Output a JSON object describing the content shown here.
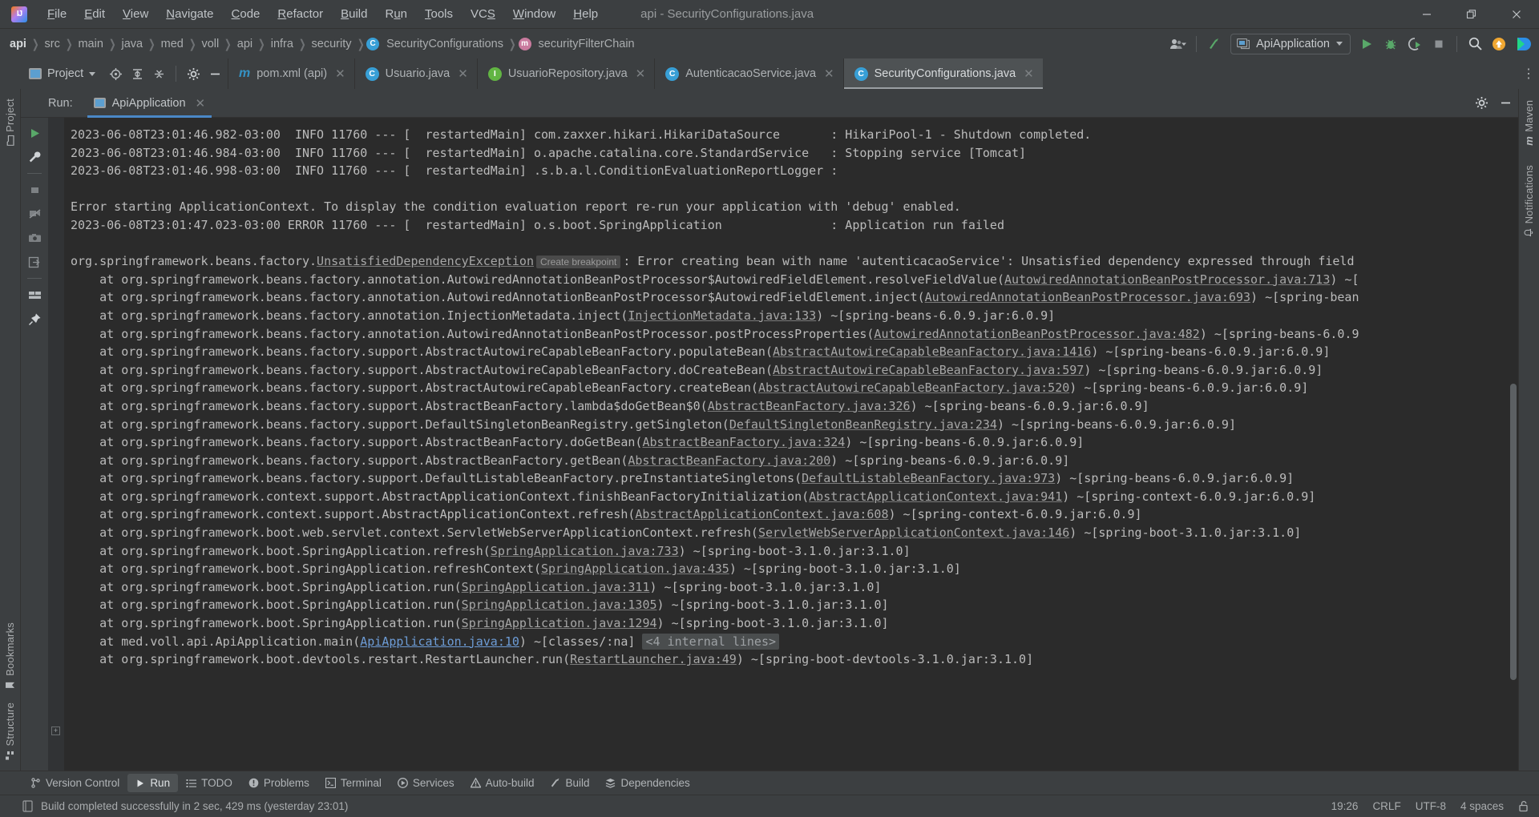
{
  "window": {
    "title": "api - SecurityConfigurations.java",
    "logo_text": "IJ",
    "minimize": "–",
    "maximize": "▢",
    "close": "✕"
  },
  "menu": [
    {
      "label": "File"
    },
    {
      "label": "Edit"
    },
    {
      "label": "View"
    },
    {
      "label": "Navigate"
    },
    {
      "label": "Code"
    },
    {
      "label": "Refactor"
    },
    {
      "label": "Build"
    },
    {
      "label": "Run"
    },
    {
      "label": "Tools"
    },
    {
      "label": "VCS"
    },
    {
      "label": "Window"
    },
    {
      "label": "Help"
    }
  ],
  "breadcrumbs": [
    {
      "label": "api",
      "badge": "",
      "bold": true
    },
    {
      "label": "src",
      "badge": ""
    },
    {
      "label": "main",
      "badge": ""
    },
    {
      "label": "java",
      "badge": ""
    },
    {
      "label": "med",
      "badge": ""
    },
    {
      "label": "voll",
      "badge": ""
    },
    {
      "label": "api",
      "badge": ""
    },
    {
      "label": "infra",
      "badge": ""
    },
    {
      "label": "security",
      "badge": ""
    },
    {
      "label": "SecurityConfigurations",
      "badge": "C"
    },
    {
      "label": "securityFilterChain",
      "badge": "m"
    }
  ],
  "toolbar": {
    "run_config": "ApiApplication",
    "icons": [
      "user-avatar-icon",
      "updates-icon",
      "run-config-icon",
      "run-icon",
      "debug-icon",
      "run-coverage-icon",
      "stop-icon",
      "search-everywhere-icon",
      "notifications-icon",
      "ide-services-icon"
    ]
  },
  "project_panel": {
    "title": "Project",
    "tools": [
      "locate-icon",
      "expand-all-icon",
      "collapse-all-icon",
      "settings-icon",
      "hide-icon"
    ]
  },
  "editor_tabs": [
    {
      "label": "pom.xml (api)",
      "badge": "m",
      "badge_type": "maven",
      "active": false
    },
    {
      "label": "Usuario.java",
      "badge": "C",
      "badge_type": "class",
      "active": false
    },
    {
      "label": "UsuarioRepository.java",
      "badge": "I",
      "badge_type": "interface",
      "active": false
    },
    {
      "label": "AutenticacaoService.java",
      "badge": "C",
      "badge_type": "class",
      "active": false
    },
    {
      "label": "SecurityConfigurations.java",
      "badge": "C",
      "badge_type": "class",
      "active": true
    }
  ],
  "run_panel": {
    "label": "Run:",
    "tab": "ApiApplication",
    "side_tools": [
      "rerun-icon",
      "settings-wrench-icon",
      "stop-icon",
      "suppress-icon",
      "camera-icon",
      "export-icon",
      "layout-icon",
      "pin-icon"
    ]
  },
  "console": {
    "lines": [
      {
        "segments": [
          {
            "t": "2023-06-08T23:01:46.982-03:00  INFO 11760 --- [  restartedMain] com.zaxxer.hikari.HikariDataSource       : HikariPool-1 - Shutdown completed."
          }
        ]
      },
      {
        "segments": [
          {
            "t": "2023-06-08T23:01:46.984-03:00  INFO 11760 --- [  restartedMain] o.apache.catalina.core.StandardService   : Stopping service [Tomcat]"
          }
        ]
      },
      {
        "segments": [
          {
            "t": "2023-06-08T23:01:46.998-03:00  INFO 11760 --- [  restartedMain] .s.b.a.l.ConditionEvaluationReportLogger :"
          }
        ]
      },
      {
        "segments": [
          {
            "t": ""
          }
        ]
      },
      {
        "segments": [
          {
            "t": "Error starting ApplicationContext. To display the condition evaluation report re-run your application with 'debug' enabled."
          }
        ]
      },
      {
        "segments": [
          {
            "t": "2023-06-08T23:01:47.023-03:00 ERROR 11760 --- [  restartedMain] o.s.boot.SpringApplication               : Application run failed"
          }
        ]
      },
      {
        "segments": [
          {
            "t": ""
          }
        ]
      },
      {
        "segments": [
          {
            "t": "org.springframework.beans.factory."
          },
          {
            "t": "UnsatisfiedDependencyException",
            "k": "link"
          },
          {
            "t": "Create breakpoint",
            "k": "bkpt"
          },
          {
            "t": ": Error creating bean with name 'autenticacaoService': Unsatisfied dependency expressed through field"
          }
        ]
      },
      {
        "segments": [
          {
            "t": "    at org.springframework.beans.factory.annotation.AutowiredAnnotationBeanPostProcessor$AutowiredFieldElement.resolveFieldValue("
          },
          {
            "t": "AutowiredAnnotationBeanPostProcessor.java:713",
            "k": "link"
          },
          {
            "t": ") ~["
          }
        ]
      },
      {
        "segments": [
          {
            "t": "    at org.springframework.beans.factory.annotation.AutowiredAnnotationBeanPostProcessor$AutowiredFieldElement.inject("
          },
          {
            "t": "AutowiredAnnotationBeanPostProcessor.java:693",
            "k": "link"
          },
          {
            "t": ") ~[spring-bean"
          }
        ]
      },
      {
        "segments": [
          {
            "t": "    at org.springframework.beans.factory.annotation.InjectionMetadata.inject("
          },
          {
            "t": "InjectionMetadata.java:133",
            "k": "link"
          },
          {
            "t": ") ~[spring-beans-6.0.9.jar:6.0.9]"
          }
        ]
      },
      {
        "segments": [
          {
            "t": "    at org.springframework.beans.factory.annotation.AutowiredAnnotationBeanPostProcessor.postProcessProperties("
          },
          {
            "t": "AutowiredAnnotationBeanPostProcessor.java:482",
            "k": "link"
          },
          {
            "t": ") ~[spring-beans-6.0.9"
          }
        ]
      },
      {
        "segments": [
          {
            "t": "    at org.springframework.beans.factory.support.AbstractAutowireCapableBeanFactory.populateBean("
          },
          {
            "t": "AbstractAutowireCapableBeanFactory.java:1416",
            "k": "link"
          },
          {
            "t": ") ~[spring-beans-6.0.9.jar:6.0.9]"
          }
        ]
      },
      {
        "segments": [
          {
            "t": "    at org.springframework.beans.factory.support.AbstractAutowireCapableBeanFactory.doCreateBean("
          },
          {
            "t": "AbstractAutowireCapableBeanFactory.java:597",
            "k": "link"
          },
          {
            "t": ") ~[spring-beans-6.0.9.jar:6.0.9]"
          }
        ]
      },
      {
        "segments": [
          {
            "t": "    at org.springframework.beans.factory.support.AbstractAutowireCapableBeanFactory.createBean("
          },
          {
            "t": "AbstractAutowireCapableBeanFactory.java:520",
            "k": "link"
          },
          {
            "t": ") ~[spring-beans-6.0.9.jar:6.0.9]"
          }
        ]
      },
      {
        "segments": [
          {
            "t": "    at org.springframework.beans.factory.support.AbstractBeanFactory.lambda$doGetBean$0("
          },
          {
            "t": "AbstractBeanFactory.java:326",
            "k": "link"
          },
          {
            "t": ") ~[spring-beans-6.0.9.jar:6.0.9]"
          }
        ]
      },
      {
        "segments": [
          {
            "t": "    at org.springframework.beans.factory.support.DefaultSingletonBeanRegistry.getSingleton("
          },
          {
            "t": "DefaultSingletonBeanRegistry.java:234",
            "k": "link"
          },
          {
            "t": ") ~[spring-beans-6.0.9.jar:6.0.9]"
          }
        ]
      },
      {
        "segments": [
          {
            "t": "    at org.springframework.beans.factory.support.AbstractBeanFactory.doGetBean("
          },
          {
            "t": "AbstractBeanFactory.java:324",
            "k": "link"
          },
          {
            "t": ") ~[spring-beans-6.0.9.jar:6.0.9]"
          }
        ]
      },
      {
        "segments": [
          {
            "t": "    at org.springframework.beans.factory.support.AbstractBeanFactory.getBean("
          },
          {
            "t": "AbstractBeanFactory.java:200",
            "k": "link"
          },
          {
            "t": ") ~[spring-beans-6.0.9.jar:6.0.9]"
          }
        ]
      },
      {
        "segments": [
          {
            "t": "    at org.springframework.beans.factory.support.DefaultListableBeanFactory.preInstantiateSingletons("
          },
          {
            "t": "DefaultListableBeanFactory.java:973",
            "k": "link"
          },
          {
            "t": ") ~[spring-beans-6.0.9.jar:6.0.9]"
          }
        ]
      },
      {
        "segments": [
          {
            "t": "    at org.springframework.context.support.AbstractApplicationContext.finishBeanFactoryInitialization("
          },
          {
            "t": "AbstractApplicationContext.java:941",
            "k": "link"
          },
          {
            "t": ") ~[spring-context-6.0.9.jar:6.0.9]"
          }
        ]
      },
      {
        "segments": [
          {
            "t": "    at org.springframework.context.support.AbstractApplicationContext.refresh("
          },
          {
            "t": "AbstractApplicationContext.java:608",
            "k": "link"
          },
          {
            "t": ") ~[spring-context-6.0.9.jar:6.0.9]"
          }
        ]
      },
      {
        "segments": [
          {
            "t": "    at org.springframework.boot.web.servlet.context.ServletWebServerApplicationContext.refresh("
          },
          {
            "t": "ServletWebServerApplicationContext.java:146",
            "k": "link"
          },
          {
            "t": ") ~[spring-boot-3.1.0.jar:3.1.0]"
          }
        ]
      },
      {
        "segments": [
          {
            "t": "    at org.springframework.boot.SpringApplication.refresh("
          },
          {
            "t": "SpringApplication.java:733",
            "k": "link"
          },
          {
            "t": ") ~[spring-boot-3.1.0.jar:3.1.0]"
          }
        ]
      },
      {
        "segments": [
          {
            "t": "    at org.springframework.boot.SpringApplication.refreshContext("
          },
          {
            "t": "SpringApplication.java:435",
            "k": "link"
          },
          {
            "t": ") ~[spring-boot-3.1.0.jar:3.1.0]"
          }
        ]
      },
      {
        "segments": [
          {
            "t": "    at org.springframework.boot.SpringApplication.run("
          },
          {
            "t": "SpringApplication.java:311",
            "k": "link"
          },
          {
            "t": ") ~[spring-boot-3.1.0.jar:3.1.0]"
          }
        ]
      },
      {
        "segments": [
          {
            "t": "    at org.springframework.boot.SpringApplication.run("
          },
          {
            "t": "SpringApplication.java:1305",
            "k": "link"
          },
          {
            "t": ") ~[spring-boot-3.1.0.jar:3.1.0]"
          }
        ]
      },
      {
        "segments": [
          {
            "t": "    at org.springframework.boot.SpringApplication.run("
          },
          {
            "t": "SpringApplication.java:1294",
            "k": "link"
          },
          {
            "t": ") ~[spring-boot-3.1.0.jar:3.1.0]"
          }
        ]
      },
      {
        "segments": [
          {
            "t": "    at med.voll.api.ApiApplication.main("
          },
          {
            "t": "ApiApplication.java:10",
            "k": "bluelink"
          },
          {
            "t": ") ~[classes/:na] "
          },
          {
            "t": "<4 internal lines>",
            "k": "internal"
          }
        ]
      },
      {
        "segments": [
          {
            "t": "    at org.springframework.boot.devtools.restart.RestartLauncher.run("
          },
          {
            "t": "RestartLauncher.java:49",
            "k": "link"
          },
          {
            "t": ") ~[spring-boot-devtools-3.1.0.jar:3.1.0]"
          }
        ]
      }
    ]
  },
  "tool_windows": [
    {
      "label": "Version Control",
      "icon": "branch-icon",
      "active": false
    },
    {
      "label": "Run",
      "icon": "run-icon",
      "active": true
    },
    {
      "label": "TODO",
      "icon": "todo-icon",
      "active": false
    },
    {
      "label": "Problems",
      "icon": "problems-icon",
      "active": false
    },
    {
      "label": "Terminal",
      "icon": "terminal-icon",
      "active": false
    },
    {
      "label": "Services",
      "icon": "services-icon",
      "active": false
    },
    {
      "label": "Auto-build",
      "icon": "autobuild-icon",
      "active": false
    },
    {
      "label": "Build",
      "icon": "build-icon",
      "active": false
    },
    {
      "label": "Dependencies",
      "icon": "dependencies-icon",
      "active": false
    }
  ],
  "left_stripe": [
    {
      "label": "Project"
    },
    {
      "label": "Bookmarks"
    },
    {
      "label": "Structure"
    }
  ],
  "right_stripe": [
    {
      "label": "Maven"
    },
    {
      "label": "Notifications"
    }
  ],
  "status_bar": {
    "message": "Build completed successfully in 2 sec, 429 ms (yesterday 23:01)",
    "right": {
      "position": "19:26",
      "line_separator": "CRLF",
      "encoding": "UTF-8",
      "indent": "4 spaces",
      "lock": "lock-icon"
    }
  },
  "colors": {
    "accent_blue": "#4a88c7",
    "class_badge": "#389fd6",
    "interface_badge": "#62b543",
    "method_badge": "#c97b9e",
    "run_green": "#59a869",
    "console_bg": "#2b2b2b",
    "chrome_bg": "#3c3f41"
  }
}
